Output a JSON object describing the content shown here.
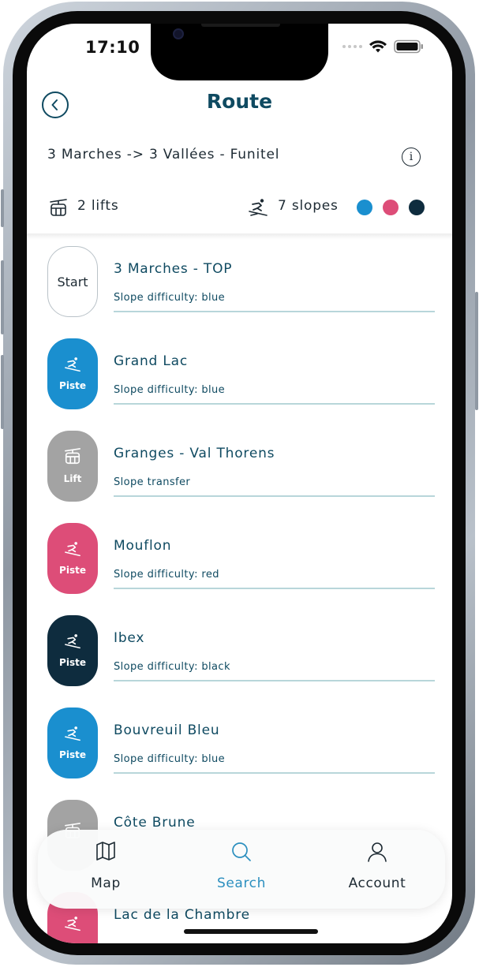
{
  "status_bar": {
    "time": "17:10"
  },
  "header": {
    "title": "Route"
  },
  "route": {
    "name": "3 Marches -> 3 Vallées - Funitel"
  },
  "summary": {
    "lifts_text": "2 lifts",
    "slopes_text": "7 slopes",
    "difficulty_colors": [
      "#1a8fcf",
      "#dd4d78",
      "#0e2c3e"
    ]
  },
  "colors": {
    "accent": "#0f4a61",
    "blue": "#1a8fcf",
    "red": "#dd4d78",
    "black": "#0e2c3e",
    "lift": "#a3a3a3",
    "search_active": "#2b8fbf"
  },
  "list": {
    "items": [
      {
        "badge": "Start",
        "type": "start",
        "title": "3 Marches - TOP",
        "subtitle": "Slope difficulty: blue"
      },
      {
        "badge": "Piste",
        "type": "blue",
        "icon": "skier-icon",
        "title": "Grand Lac",
        "subtitle": "Slope difficulty: blue"
      },
      {
        "badge": "Lift",
        "type": "lift",
        "icon": "gondola-icon",
        "title": "Granges - Val Thorens",
        "subtitle": "Slope transfer"
      },
      {
        "badge": "Piste",
        "type": "red",
        "icon": "skier-icon",
        "title": "Mouflon",
        "subtitle": "Slope difficulty: red"
      },
      {
        "badge": "Piste",
        "type": "black",
        "icon": "skier-icon",
        "title": "Ibex",
        "subtitle": "Slope difficulty: black"
      },
      {
        "badge": "Piste",
        "type": "blue",
        "icon": "skier-icon",
        "title": "Bouvreuil Bleu",
        "subtitle": "Slope difficulty: blue"
      },
      {
        "badge": "",
        "type": "lift",
        "icon": "gondola-icon",
        "title": "Côte Brune",
        "subtitle": ""
      },
      {
        "badge": "",
        "type": "red",
        "icon": "skier-icon",
        "title": "Lac de la Chambre",
        "subtitle": ""
      }
    ]
  },
  "tabbar": {
    "tabs": [
      {
        "label": "Map",
        "icon": "map-icon",
        "active": false
      },
      {
        "label": "Search",
        "icon": "search-icon",
        "active": true
      },
      {
        "label": "Account",
        "icon": "account-icon",
        "active": false
      }
    ]
  }
}
